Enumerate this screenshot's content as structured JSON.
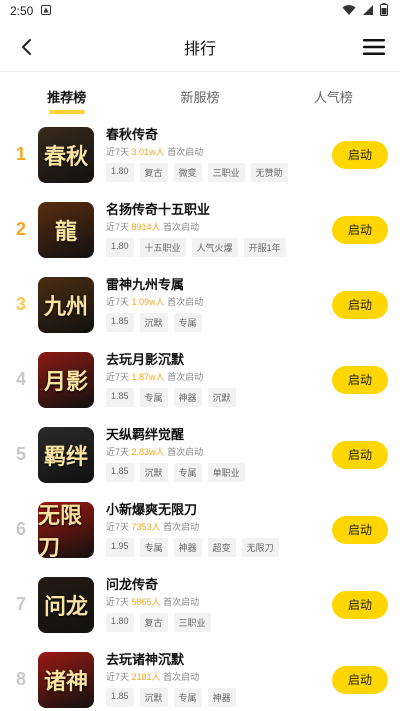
{
  "status": {
    "time": "2:50"
  },
  "header": {
    "title": "排行"
  },
  "tabs": [
    {
      "label": "推荐榜",
      "active": true
    },
    {
      "label": "新服榜",
      "active": false
    },
    {
      "label": "人气榜",
      "active": false
    }
  ],
  "games": [
    {
      "rank": "1",
      "name": "春秋传奇",
      "meta_prefix": "近7天",
      "hot": "3.01w人",
      "meta_suffix": "首次启动",
      "thumb_text": "春秋",
      "thumb_bg": "#3a2a1c",
      "tags": [
        "1.80",
        "复古",
        "微变",
        "三职业",
        "无赞助"
      ],
      "button": "启动"
    },
    {
      "rank": "2",
      "name": "名扬传奇十五职业",
      "meta_prefix": "近7天",
      "hot": "8914人",
      "meta_suffix": "首次启动",
      "thumb_text": "龍",
      "thumb_bg": "#5a2d10",
      "tags": [
        "1.80",
        "十五职业",
        "人气火爆",
        "开服1年"
      ],
      "button": "启动"
    },
    {
      "rank": "3",
      "name": "雷神九州专属",
      "meta_prefix": "近7天",
      "hot": "1.09w人",
      "meta_suffix": "首次启动",
      "thumb_text": "九州",
      "thumb_bg": "#4b2d12",
      "tags": [
        "1.85",
        "沉默",
        "专属"
      ],
      "button": "启动"
    },
    {
      "rank": "4",
      "name": "去玩月影沉默",
      "meta_prefix": "近7天",
      "hot": "1.87w人",
      "meta_suffix": "首次启动",
      "thumb_text": "月影",
      "thumb_bg": "#8b1a12",
      "tags": [
        "1.85",
        "专属",
        "神器",
        "沉默"
      ],
      "button": "启动"
    },
    {
      "rank": "5",
      "name": "天纵羁绊觉醒",
      "meta_prefix": "近7天",
      "hot": "2.83w人",
      "meta_suffix": "首次启动",
      "thumb_text": "羁绊",
      "thumb_bg": "#2a2a2a",
      "tags": [
        "1.85",
        "沉默",
        "专属",
        "单职业"
      ],
      "button": "启动"
    },
    {
      "rank": "6",
      "name": "小新爆爽无限刀",
      "meta_prefix": "近7天",
      "hot": "7353人",
      "meta_suffix": "首次启动",
      "thumb_text": "无限刀",
      "thumb_bg": "#a0190f",
      "tags": [
        "1.95",
        "专属",
        "神器",
        "超变",
        "无限刀"
      ],
      "button": "启动"
    },
    {
      "rank": "7",
      "name": "问龙传奇",
      "meta_prefix": "近7天",
      "hot": "5865人",
      "meta_suffix": "首次启动",
      "thumb_text": "问龙",
      "thumb_bg": "#231a14",
      "tags": [
        "1.80",
        "复古",
        "三职业"
      ],
      "button": "启动"
    },
    {
      "rank": "8",
      "name": "去玩诸神沉默",
      "meta_prefix": "近7天",
      "hot": "2181人",
      "meta_suffix": "首次启动",
      "thumb_text": "诸神",
      "thumb_bg": "#9a1a12",
      "tags": [
        "1.85",
        "沉默",
        "专属",
        "神器"
      ],
      "button": "启动"
    }
  ]
}
